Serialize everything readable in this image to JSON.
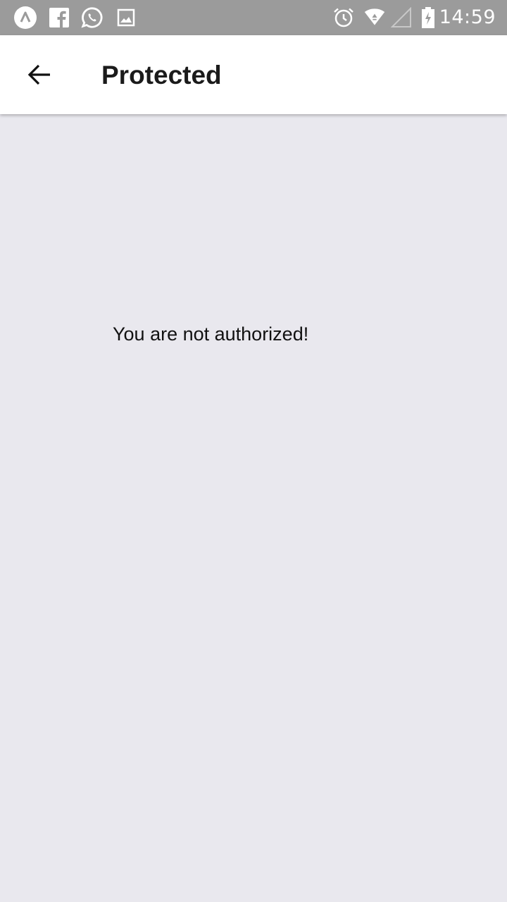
{
  "status_bar": {
    "time": "14:59",
    "left_icons": [
      "app-a-icon",
      "facebook-icon",
      "whatsapp-icon",
      "gallery-icon"
    ],
    "right_icons": [
      "alarm-icon",
      "wifi-icon",
      "signal-icon",
      "battery-charging-icon"
    ],
    "background": "#9b9b9b"
  },
  "app_bar": {
    "title": "Protected",
    "back_icon": "arrow-left-icon"
  },
  "content": {
    "message": "You are not authorized!",
    "background": "#e9e8ee"
  }
}
